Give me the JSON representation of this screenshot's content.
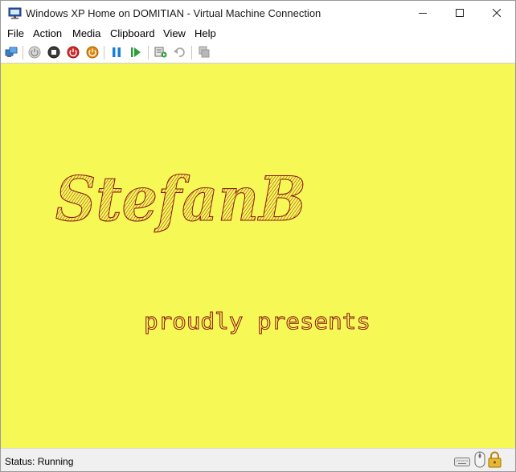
{
  "window": {
    "title": "Windows XP Home on DOMITIAN - Virtual Machine Connection"
  },
  "menu": [
    {
      "label": "File"
    },
    {
      "label": "Action"
    },
    {
      "label": "Media"
    },
    {
      "label": "Clipboard"
    },
    {
      "label": "View"
    },
    {
      "label": "Help"
    }
  ],
  "toolbar": {
    "icons": [
      "ctrl-alt-del-icon",
      "start-icon",
      "turn-off-icon",
      "shut-down-icon",
      "save-icon",
      "pause-icon",
      "resume-icon",
      "checkpoint-icon",
      "revert-icon",
      "enhanced-session-icon"
    ]
  },
  "vm_screen": {
    "background_color": "#f6f855",
    "text_color": "#8a1515",
    "title": "StefanB",
    "subtitle": "proudly presents"
  },
  "status": {
    "text": "Status: Running",
    "icons": [
      "keyboard-icon",
      "mouse-icon",
      "lock-icon"
    ]
  }
}
